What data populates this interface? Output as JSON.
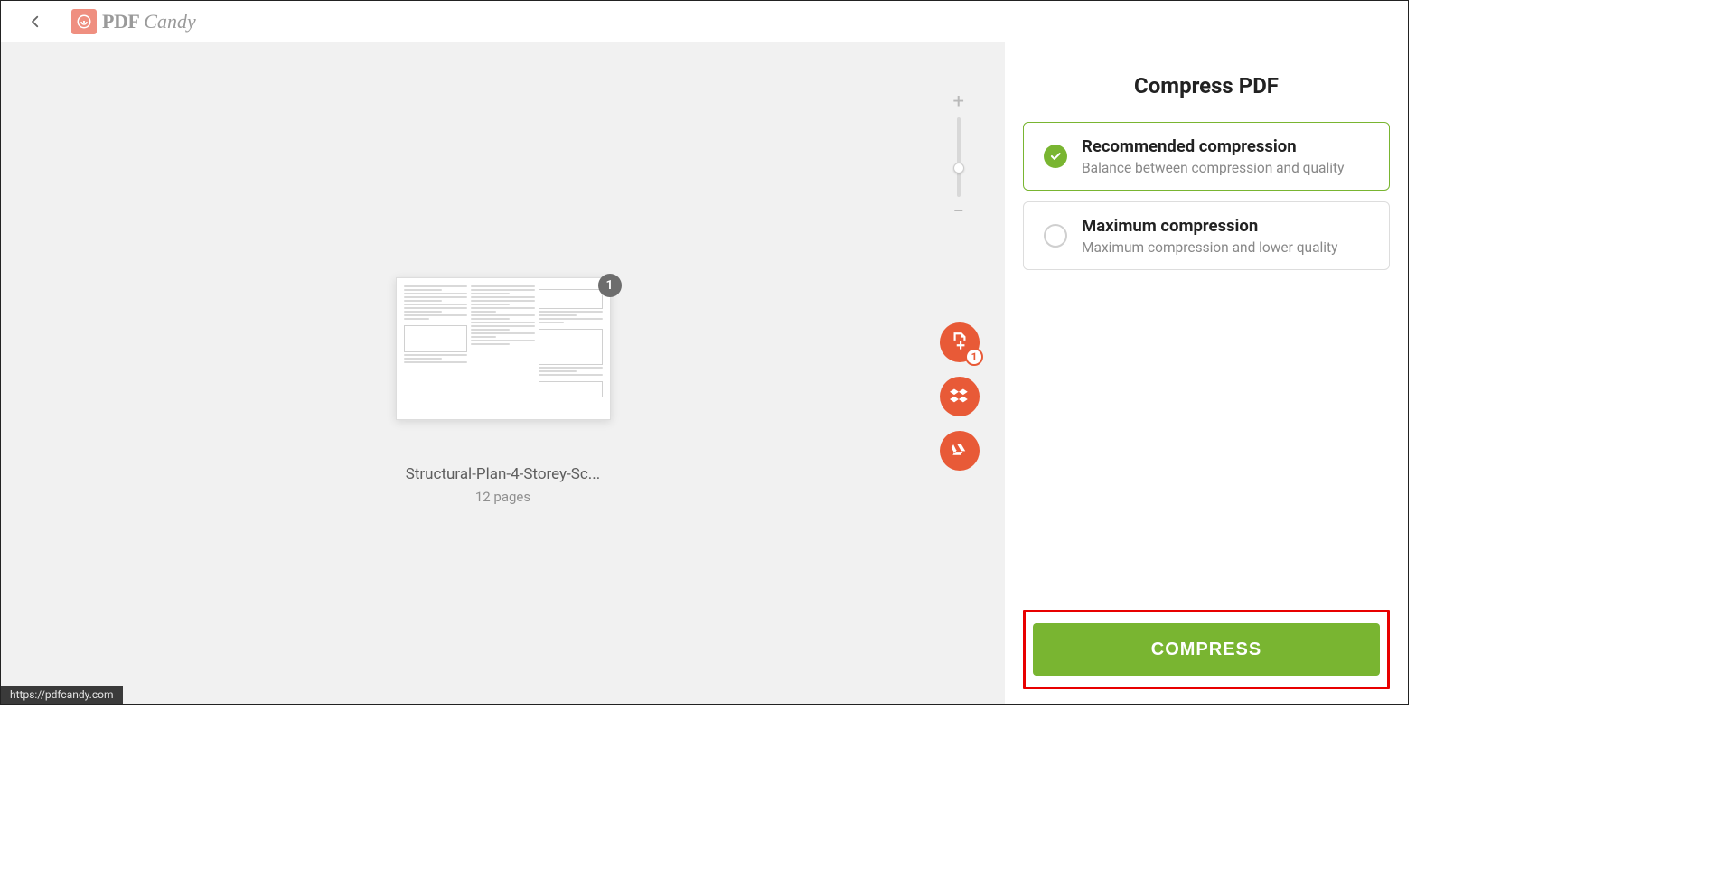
{
  "header": {
    "logo_pdf": "PDF",
    "logo_candy": "Candy"
  },
  "preview": {
    "page_badge": "1",
    "file_name": "Structural-Plan-4-Storey-Sc...",
    "file_pages": "12 pages",
    "add_file_count": "1"
  },
  "sidebar": {
    "title": "Compress PDF",
    "options": [
      {
        "title": "Recommended compression",
        "desc": "Balance between compression and quality",
        "selected": true
      },
      {
        "title": "Maximum compression",
        "desc": "Maximum compression and lower quality",
        "selected": false
      }
    ],
    "action": "COMPRESS"
  },
  "status_bar": "https://pdfcandy.com",
  "colors": {
    "accent_green": "#79b531",
    "accent_orange": "#e85a37",
    "highlight_red": "#e80000"
  }
}
